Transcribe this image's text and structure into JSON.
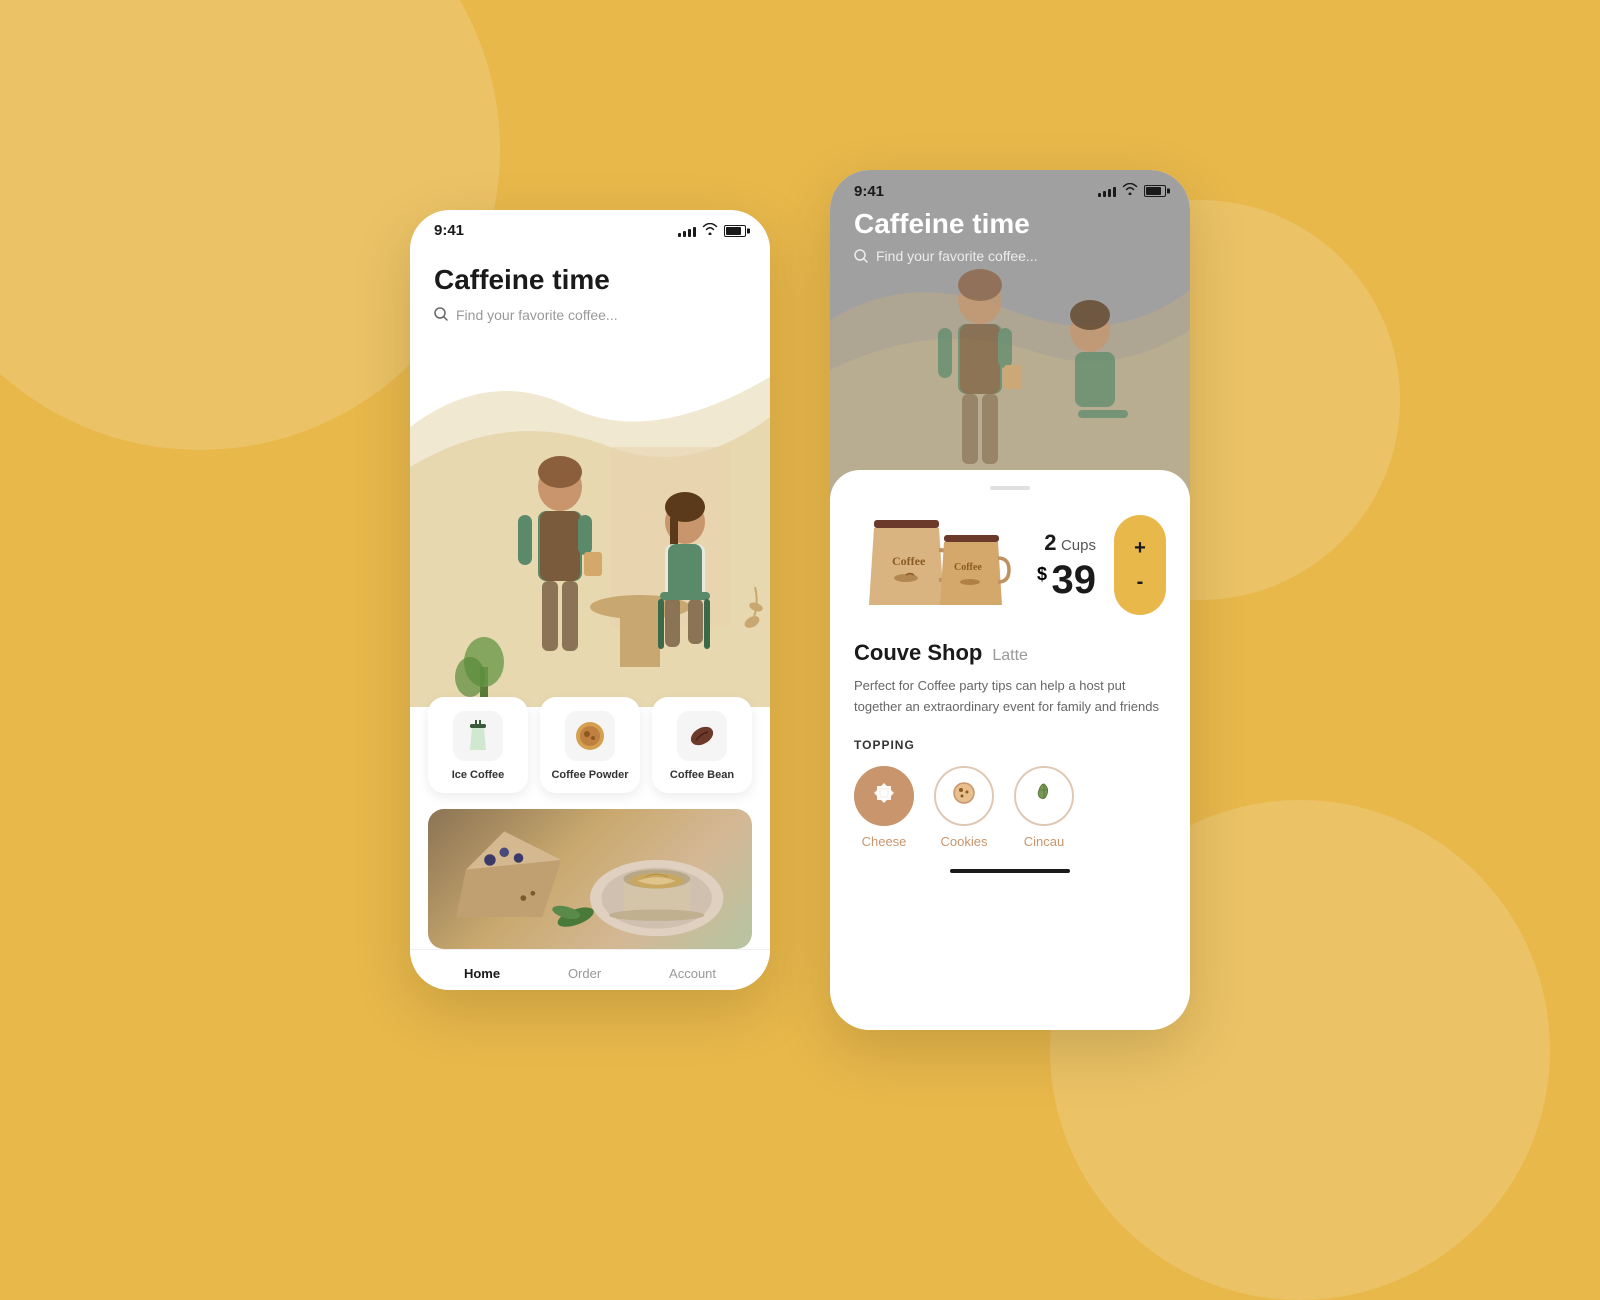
{
  "background": {
    "color": "#E8B84B"
  },
  "phone1": {
    "status_bar": {
      "time": "9:41"
    },
    "hero": {
      "title": "Caffeine time",
      "search_placeholder": "Find your favorite coffee..."
    },
    "categories": [
      {
        "id": "ice-coffee",
        "label": "Ice Coffee",
        "icon": "🧊"
      },
      {
        "id": "coffee-powder",
        "label": "Coffee Powder",
        "icon": "☕"
      },
      {
        "id": "coffee-bean",
        "label": "Coffee Bean",
        "icon": "🫘"
      }
    ],
    "bottom_nav": [
      {
        "id": "home",
        "label": "Home",
        "active": true
      },
      {
        "id": "order",
        "label": "Order",
        "active": false
      },
      {
        "id": "account",
        "label": "Account",
        "active": false
      }
    ]
  },
  "phone2": {
    "status_bar": {
      "time": "9:41"
    },
    "header": {
      "title": "Caffeine time",
      "search_placeholder": "Find your favorite coffee..."
    },
    "product": {
      "cups_count": "2",
      "cups_label": "Cups",
      "price_symbol": "$",
      "price": "39",
      "shop_name": "Couve Shop",
      "product_type": "Latte",
      "description": "Perfect for Coffee party tips can help a host put together an extraordinary event for family and friends"
    },
    "topping": {
      "title": "TOPPING",
      "items": [
        {
          "id": "cheese",
          "label": "Cheese",
          "icon": "🏠",
          "active": true
        },
        {
          "id": "cookies",
          "label": "Cookies",
          "icon": "🍪",
          "active": false
        },
        {
          "id": "cincau",
          "label": "Cincau",
          "icon": "🌿",
          "active": false
        }
      ]
    },
    "qty_control": {
      "plus": "+",
      "minus": "-"
    }
  }
}
